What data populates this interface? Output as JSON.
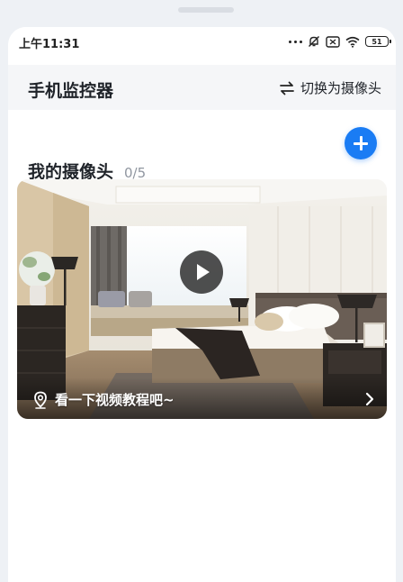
{
  "status_bar": {
    "time": "上午11:31",
    "battery": "51"
  },
  "app_bar": {
    "title": "手机监控器",
    "switch_label": "切换为摄像头"
  },
  "cameras": {
    "title": "我的摄像头",
    "count": "0/5"
  },
  "video_card": {
    "tutorial_text": "看一下视频教程吧~"
  },
  "colors": {
    "accent": "#1a7cf4",
    "background": "#eef1f5"
  },
  "icons": [
    "location-pin-icon",
    "play-icon",
    "chevron-right-icon",
    "switch-arrows-icon",
    "plus-icon"
  ]
}
